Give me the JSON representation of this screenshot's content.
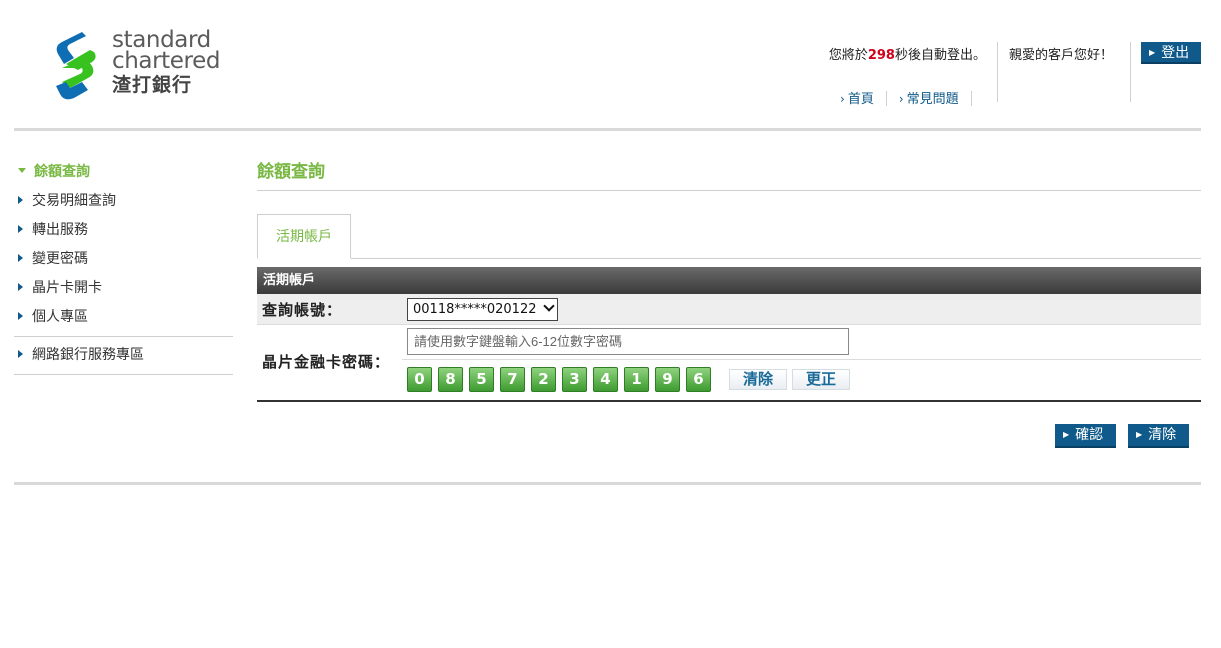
{
  "brand": {
    "line1": "standard",
    "line2": "chartered",
    "cn": "渣打銀行",
    "colors": {
      "blue": "#0f6db3",
      "green": "#38c21f"
    }
  },
  "header": {
    "autologout_prefix": "您將於",
    "autologout_seconds": "298",
    "autologout_suffix": "秒後自動登出。",
    "greeting": "親愛的客戶您好！",
    "logout_label": "登出",
    "links": [
      {
        "label": "首頁"
      },
      {
        "label": "常見問題"
      }
    ]
  },
  "sidebar": {
    "items": [
      {
        "label": "餘額查詢",
        "active": true
      },
      {
        "label": "交易明細查詢"
      },
      {
        "label": "轉出服務"
      },
      {
        "label": "變更密碼"
      },
      {
        "label": "晶片卡開卡"
      },
      {
        "label": "個人專區"
      }
    ],
    "extra_items": [
      {
        "label": "網路銀行服務專區"
      }
    ]
  },
  "main": {
    "title": "餘額查詢",
    "tabs": [
      {
        "label": "活期帳戶",
        "active": true
      }
    ],
    "section_header": "活期帳戶",
    "account_label": "查詢帳號：",
    "account_value": "00118*****020122",
    "pin_label": "晶片金融卡密碼：",
    "pin_placeholder": "請使用數字鍵盤輸入6-12位數字密碼",
    "keypad_digits": [
      "0",
      "8",
      "5",
      "7",
      "2",
      "3",
      "4",
      "1",
      "9",
      "6"
    ],
    "keypad_clear": "清除",
    "keypad_correct": "更正",
    "confirm_label": "確認",
    "clear_label": "清除"
  },
  "colors": {
    "accent_green": "#78b843",
    "button_blue": "#0f5a8a",
    "countdown_red": "#d0021b",
    "keypad_green": "#3d9b2f"
  }
}
